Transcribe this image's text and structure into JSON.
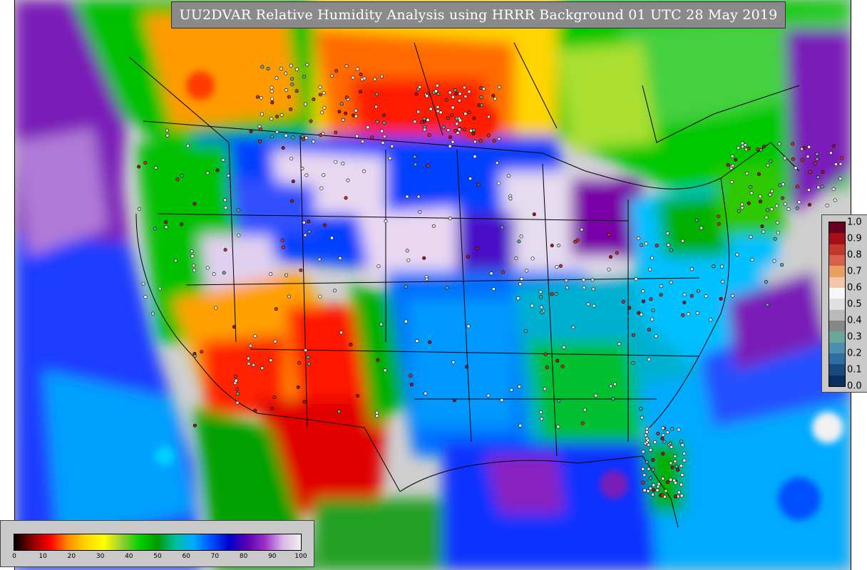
{
  "title": "UU2DVAR Relative Humidity Analysis using HRRR Background 01 UTC 28 May 2019",
  "rh_colorbar": {
    "ticks": [
      "0",
      "10",
      "20",
      "30",
      "40",
      "50",
      "60",
      "70",
      "80",
      "90",
      "100"
    ],
    "colors": [
      "#000000",
      "#8b0000",
      "#ff0000",
      "#ff8c00",
      "#ffd700",
      "#ffff00",
      "#9acd32",
      "#00d000",
      "#009900",
      "#00bfa0",
      "#00aaff",
      "#0050ff",
      "#0000cc",
      "#5a00b0",
      "#9b30c8",
      "#d8b8e8",
      "#f2f2f2"
    ]
  },
  "obs_colorbar": {
    "ticks": [
      "1.0",
      "0.9",
      "0.8",
      "0.7",
      "0.6",
      "0.5",
      "0.4",
      "0.3",
      "0.2",
      "0.1",
      "0.0"
    ],
    "colors": [
      "#67001f",
      "#a50f15",
      "#c0392b",
      "#d6604d",
      "#e8a060",
      "#f4c6a8",
      "#f7f7f7",
      "#e0e0e0",
      "#bababa",
      "#878787",
      "#6aa79a",
      "#4b8fb0",
      "#2c6fa0",
      "#184a7e",
      "#0b2f5c"
    ]
  },
  "colors": {
    "ocean_gray": "#cfcfcf",
    "panel_gray": "#c9c9c9",
    "title_bg": "#8a8a8a"
  }
}
